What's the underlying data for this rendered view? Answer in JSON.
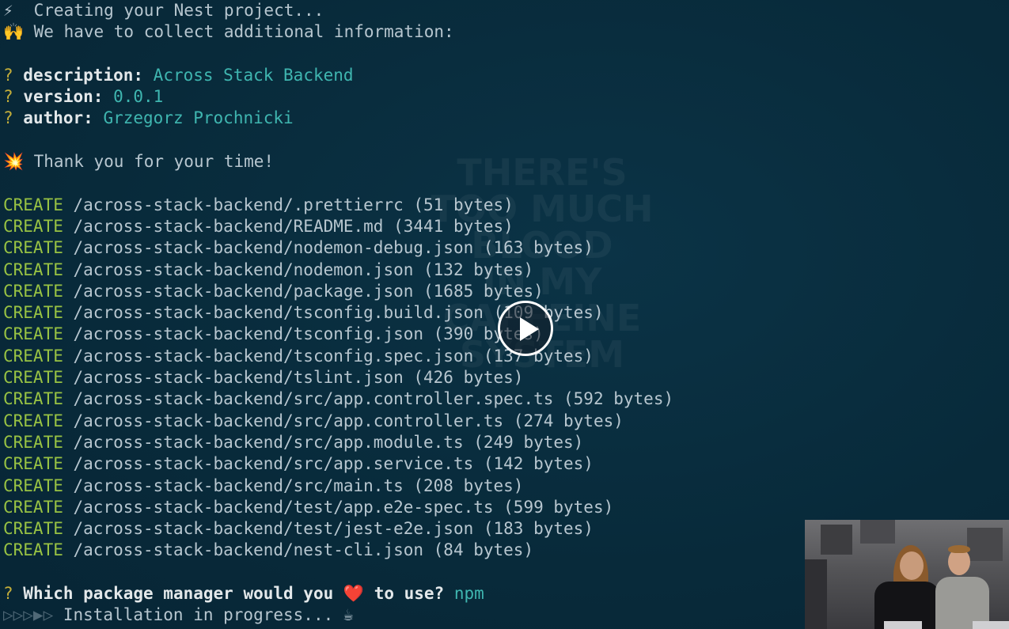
{
  "header": [
    {
      "emoji": "⚡",
      "text": " Creating your Nest project..."
    },
    {
      "emoji": "🙌",
      "text": " We have to collect additional information:"
    }
  ],
  "questions": [
    {
      "key": "description:",
      "value": "Across Stack Backend"
    },
    {
      "key": "version:",
      "value": "0.0.1"
    },
    {
      "key": "author:",
      "value": "Grzegorz Prochnicki"
    }
  ],
  "thanks": {
    "emoji": "💥",
    "text": " Thank you for your time!"
  },
  "create_label": "CREATE",
  "created_files": [
    "/across-stack-backend/.prettierrc (51 bytes)",
    "/across-stack-backend/README.md (3441 bytes)",
    "/across-stack-backend/nodemon-debug.json (163 bytes)",
    "/across-stack-backend/nodemon.json (132 bytes)",
    "/across-stack-backend/package.json (1685 bytes)",
    "/across-stack-backend/tsconfig.build.json (109 bytes)",
    "/across-stack-backend/tsconfig.json (390 bytes)",
    "/across-stack-backend/tsconfig.spec.json (137 bytes)",
    "/across-stack-backend/tslint.json (426 bytes)",
    "/across-stack-backend/src/app.controller.spec.ts (592 bytes)",
    "/across-stack-backend/src/app.controller.ts (274 bytes)",
    "/across-stack-backend/src/app.module.ts (249 bytes)",
    "/across-stack-backend/src/app.service.ts (142 bytes)",
    "/across-stack-backend/src/main.ts (208 bytes)",
    "/across-stack-backend/test/app.e2e-spec.ts (599 bytes)",
    "/across-stack-backend/test/jest-e2e.json (183 bytes)",
    "/across-stack-backend/nest-cli.json (84 bytes)"
  ],
  "package_question": {
    "mark": "?",
    "before": " Which package manager would you ",
    "heart": "❤️",
    "after": " to use? ",
    "answer": "npm"
  },
  "progress": {
    "arrows": "▷▷▷▶▷",
    "text": " Installation in progress... ",
    "emoji": "☕"
  },
  "watermark_lines": [
    "THERE'S",
    "TOO MUCH",
    "BLOOD",
    "IN MY",
    "CAFFEINE",
    "SYSTEM"
  ],
  "colors": {
    "background": "#082a3a",
    "question_mark": "#c3ad3a",
    "answer": "#3fb6b0",
    "create": "#98c243",
    "text": "#b7c6cf"
  },
  "icons": {
    "play": "play-icon",
    "webcam": "webcam-overlay"
  }
}
